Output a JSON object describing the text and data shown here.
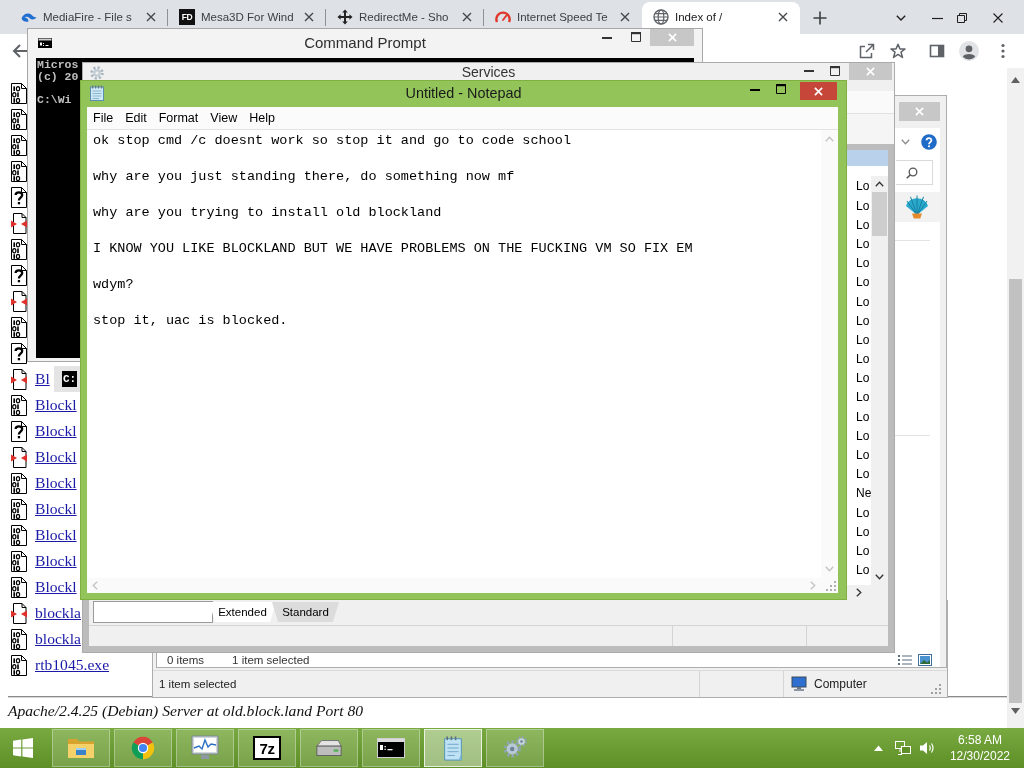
{
  "browser": {
    "tabs": [
      {
        "title": "MediaFire - File s",
        "kind": "swoosh",
        "selected": false
      },
      {
        "title": "Mesa3D For Wind",
        "kind": "letters",
        "logo_text": "FD",
        "selected": false
      },
      {
        "title": "RedirectMe - Sho",
        "kind": "move",
        "selected": false
      },
      {
        "title": "Internet Speed Te",
        "kind": "gauge",
        "selected": false
      },
      {
        "title": "Index of /",
        "kind": "globe",
        "selected": true
      }
    ],
    "listing": [
      {
        "kind": "binary"
      },
      {
        "kind": "binary"
      },
      {
        "kind": "binary"
      },
      {
        "kind": "binary"
      },
      {
        "kind": "unknown"
      },
      {
        "kind": "archive"
      },
      {
        "kind": "binary"
      },
      {
        "kind": "unknown"
      },
      {
        "kind": "archive"
      },
      {
        "kind": "binary"
      },
      {
        "kind": "unknown"
      },
      {
        "kind": "archive",
        "name": "Bl"
      },
      {
        "kind": "binary",
        "name": "Blockl"
      },
      {
        "kind": "unknown",
        "name": "Blockl"
      },
      {
        "kind": "archive",
        "name": "Blockl"
      },
      {
        "kind": "binary",
        "name": "Blockl"
      },
      {
        "kind": "binary",
        "name": "Blockl"
      },
      {
        "kind": "binary",
        "name": "Blockl"
      },
      {
        "kind": "binary",
        "name": "Blockl"
      },
      {
        "kind": "binary",
        "name": "Blockl"
      },
      {
        "kind": "archive",
        "name": "blockla"
      },
      {
        "kind": "binary",
        "name": "blockla"
      },
      {
        "kind": "binary",
        "name": "rtb1045.exe"
      }
    ],
    "footer": "Apache/2.4.25 (Debian) Server at old.block.land Port 80"
  },
  "command_prompt": {
    "title": "Command Prompt",
    "blocks": [
      [
        "Micros",
        "(c) 20"
      ],
      [
        "C:\\Wi"
      ]
    ]
  },
  "console_fragment": "C:",
  "services": {
    "title": "Services",
    "rows": [
      "Lo",
      "Lo",
      "Lo",
      "Lo",
      "Lo",
      "Lo",
      "Lo",
      "Lo",
      "Lo",
      "Lo",
      "Lo",
      "Lo",
      "Lo",
      "Lo",
      "Lo",
      "Lo",
      "Ne",
      "Lo",
      "Lo",
      "Lo",
      "Lo"
    ],
    "tabs": [
      {
        "label": "Extended",
        "selected": true
      },
      {
        "label": "Standard",
        "selected": false
      }
    ]
  },
  "notepad": {
    "title": "Untitled - Notepad",
    "menu": [
      "File",
      "Edit",
      "Format",
      "View",
      "Help"
    ],
    "paragraphs": [
      "ok stop cmd /c doesnt work so stop it and go to code school",
      "why are you just standing there, do something now mf",
      "why are you trying to install old blockland",
      "I KNOW YOU LIKE BLOCKLAND BUT WE HAVE PROBLEMS ON THE FUCKING VM SO FIX EM",
      "wdym?",
      "stop it, uac is blocked."
    ]
  },
  "explorer": {
    "status": [
      "0 items",
      "1 item selected"
    ]
  },
  "status_window": {
    "status": "1 item selected",
    "zone": "Computer"
  },
  "taskbar": {
    "apps": [
      {
        "kind": "folder",
        "selected": false
      },
      {
        "kind": "browser",
        "selected": false
      },
      {
        "kind": "monitor",
        "selected": false
      },
      {
        "kind": "archiver",
        "logo_text": "7z",
        "selected": false
      },
      {
        "kind": "drive",
        "selected": false
      },
      {
        "kind": "console",
        "selected": false
      },
      {
        "kind": "notepad",
        "selected": true
      },
      {
        "kind": "gears",
        "selected": false
      }
    ],
    "clock": {
      "time": "6:58 AM",
      "date": "12/30/2022"
    }
  }
}
